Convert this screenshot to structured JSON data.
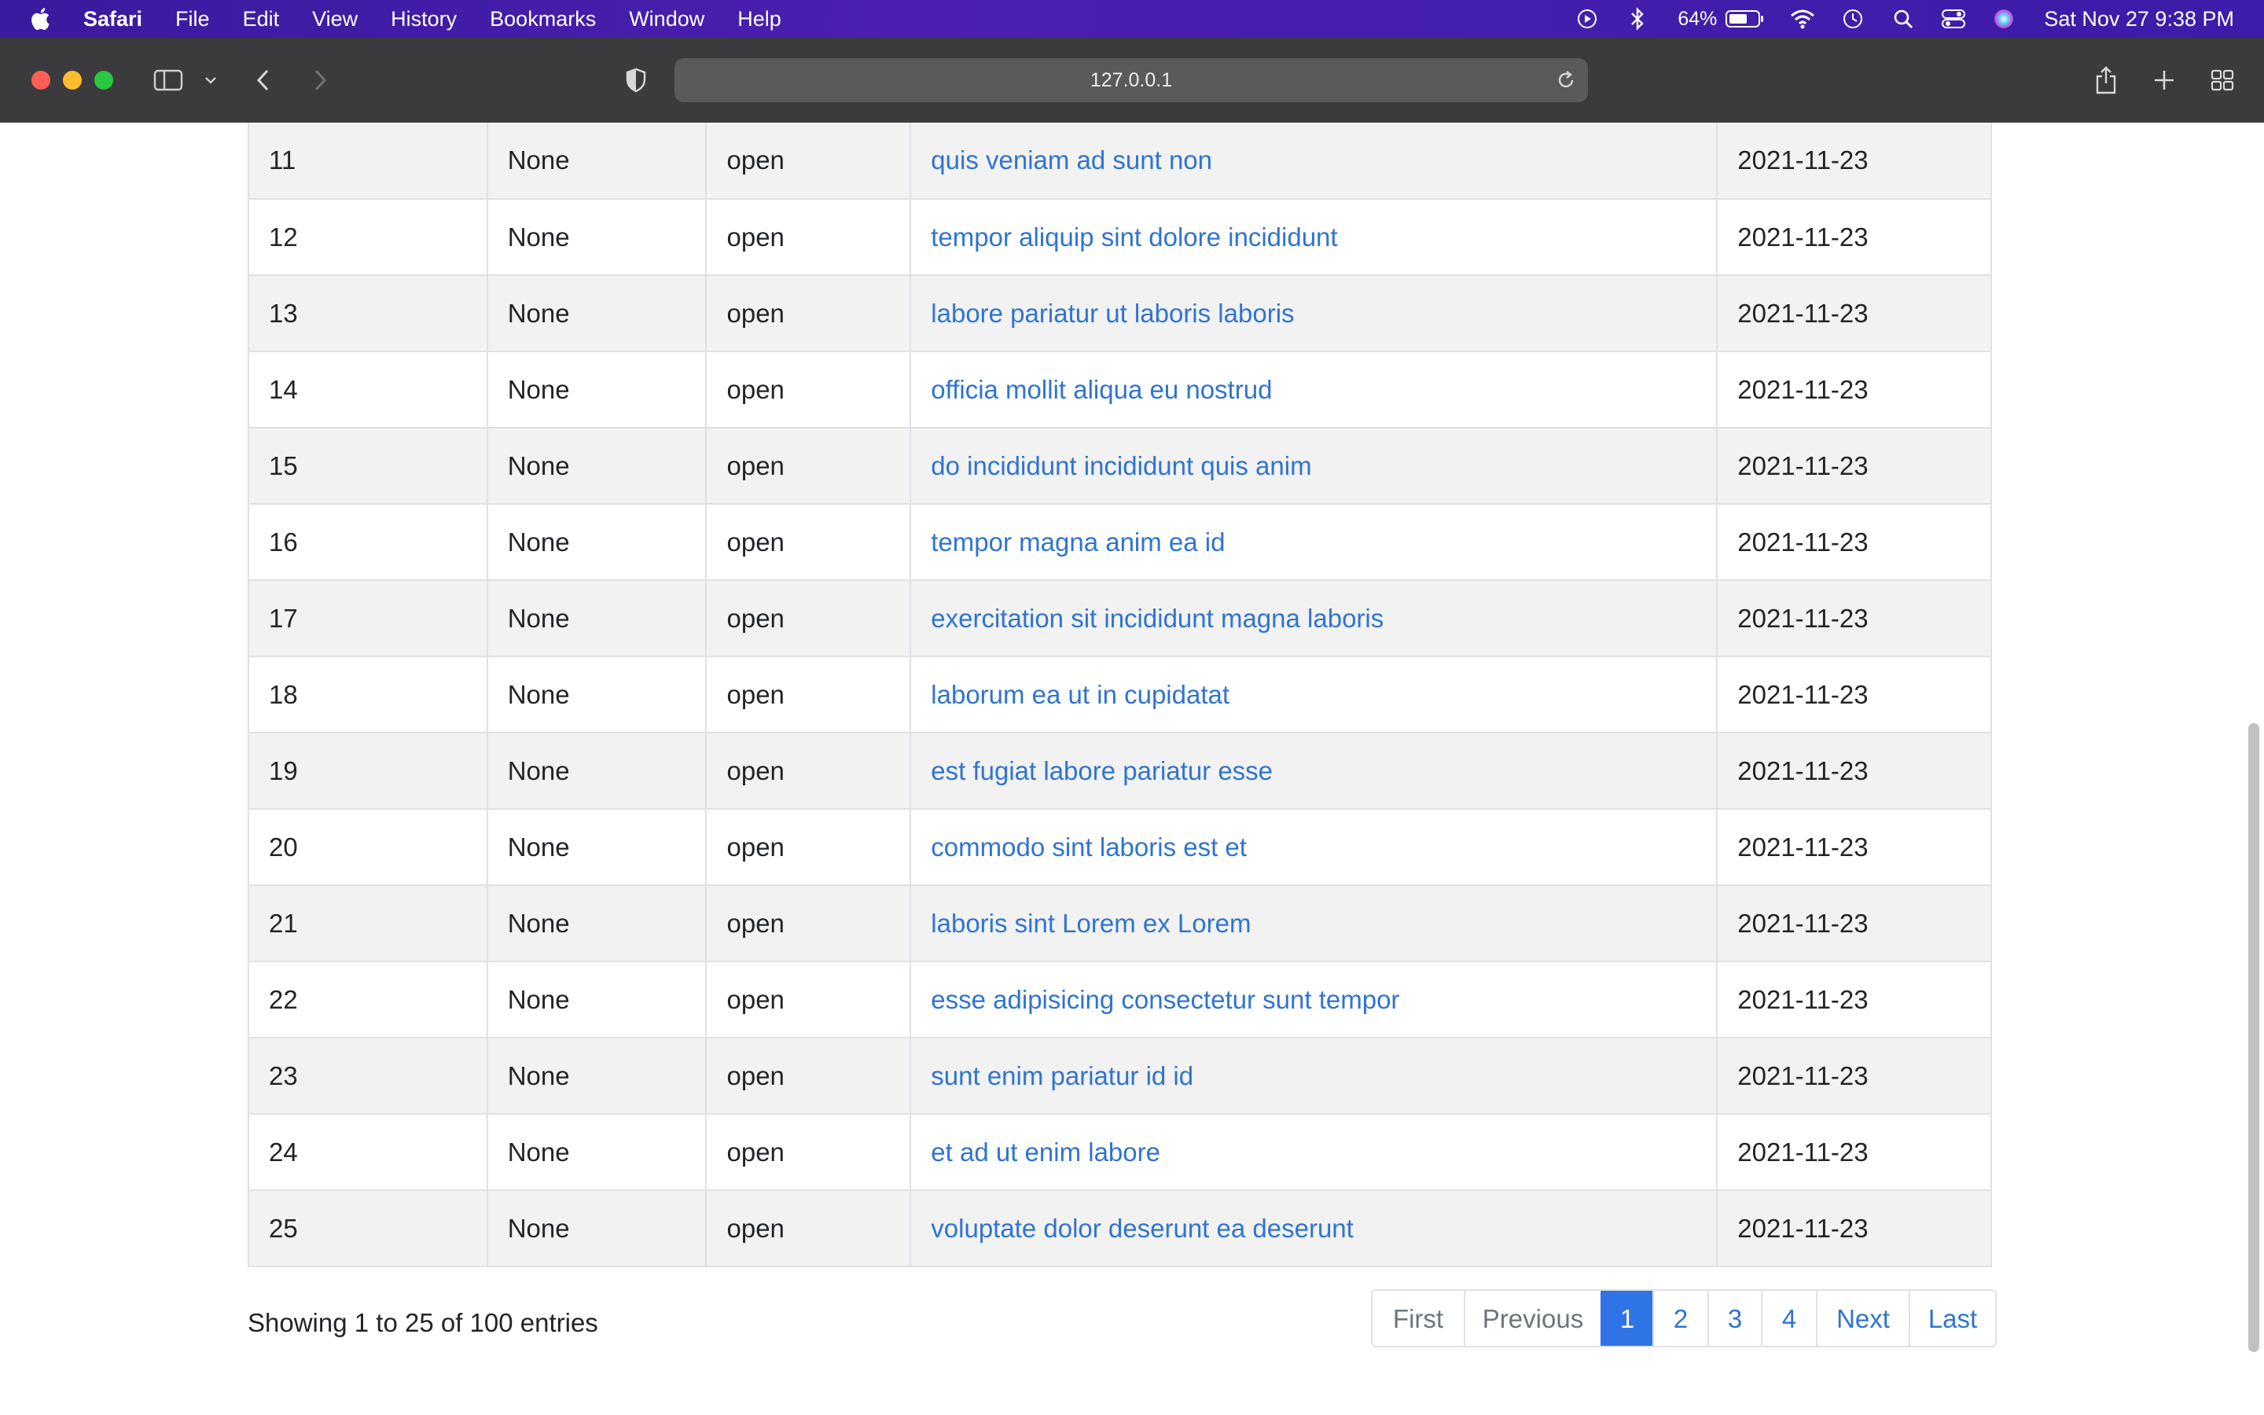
{
  "menubar": {
    "app_name": "Safari",
    "menus": [
      "File",
      "Edit",
      "View",
      "History",
      "Bookmarks",
      "Window",
      "Help"
    ],
    "battery_percent": "64%",
    "clock": "Sat Nov 27  9:38 PM"
  },
  "browser": {
    "url": "127.0.0.1"
  },
  "table": {
    "rows": [
      {
        "id": "11",
        "owner": "None",
        "state": "open",
        "title": "quis veniam ad sunt non",
        "date": "2021-11-23"
      },
      {
        "id": "12",
        "owner": "None",
        "state": "open",
        "title": "tempor aliquip sint dolore incididunt",
        "date": "2021-11-23"
      },
      {
        "id": "13",
        "owner": "None",
        "state": "open",
        "title": "labore pariatur ut laboris laboris",
        "date": "2021-11-23"
      },
      {
        "id": "14",
        "owner": "None",
        "state": "open",
        "title": "officia mollit aliqua eu nostrud",
        "date": "2021-11-23"
      },
      {
        "id": "15",
        "owner": "None",
        "state": "open",
        "title": "do incididunt incididunt quis anim",
        "date": "2021-11-23"
      },
      {
        "id": "16",
        "owner": "None",
        "state": "open",
        "title": "tempor magna anim ea id",
        "date": "2021-11-23"
      },
      {
        "id": "17",
        "owner": "None",
        "state": "open",
        "title": "exercitation sit incididunt magna laboris",
        "date": "2021-11-23"
      },
      {
        "id": "18",
        "owner": "None",
        "state": "open",
        "title": "laborum ea ut in cupidatat",
        "date": "2021-11-23"
      },
      {
        "id": "19",
        "owner": "None",
        "state": "open",
        "title": "est fugiat labore pariatur esse",
        "date": "2021-11-23"
      },
      {
        "id": "20",
        "owner": "None",
        "state": "open",
        "title": "commodo sint laboris est et",
        "date": "2021-11-23"
      },
      {
        "id": "21",
        "owner": "None",
        "state": "open",
        "title": "laboris sint Lorem ex Lorem",
        "date": "2021-11-23"
      },
      {
        "id": "22",
        "owner": "None",
        "state": "open",
        "title": "esse adipisicing consectetur sunt tempor",
        "date": "2021-11-23"
      },
      {
        "id": "23",
        "owner": "None",
        "state": "open",
        "title": "sunt enim pariatur id id",
        "date": "2021-11-23"
      },
      {
        "id": "24",
        "owner": "None",
        "state": "open",
        "title": "et ad ut enim labore",
        "date": "2021-11-23"
      },
      {
        "id": "25",
        "owner": "None",
        "state": "open",
        "title": "voluptate dolor deserunt ea deserunt",
        "date": "2021-11-23"
      }
    ]
  },
  "footer": {
    "info": "Showing 1 to 25 of 100 entries",
    "pagination": [
      {
        "label": "First",
        "state": "disabled"
      },
      {
        "label": "Previous",
        "state": "disabled"
      },
      {
        "label": "1",
        "state": "active"
      },
      {
        "label": "2",
        "state": "normal"
      },
      {
        "label": "3",
        "state": "normal"
      },
      {
        "label": "4",
        "state": "normal"
      },
      {
        "label": "Next",
        "state": "normal"
      },
      {
        "label": "Last",
        "state": "normal"
      }
    ]
  },
  "colors": {
    "link": "#2f74d0",
    "active_page": "#2f74e6",
    "stripe": "#f2f2f2"
  }
}
